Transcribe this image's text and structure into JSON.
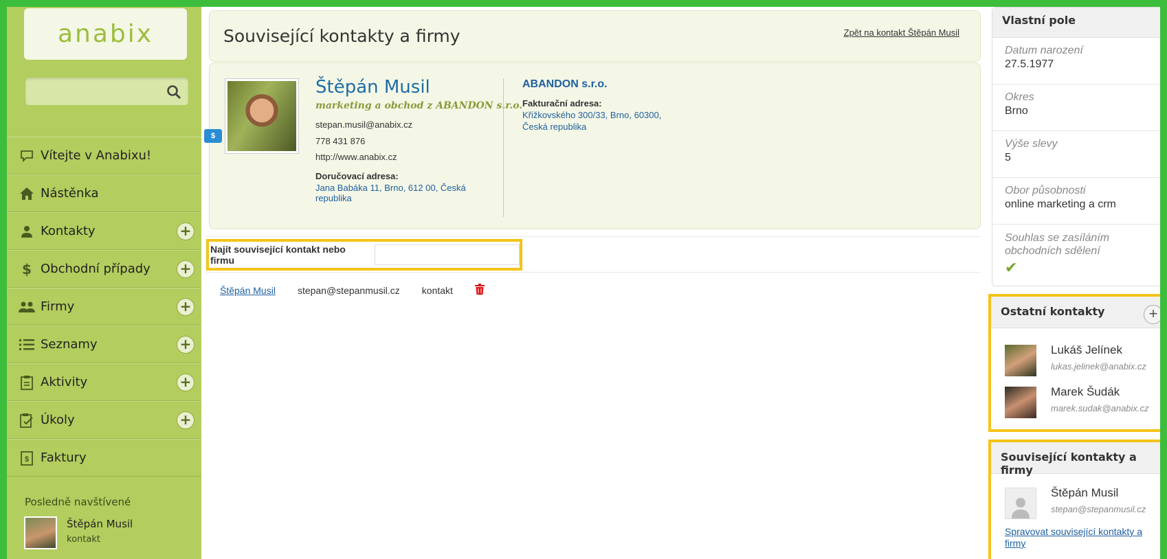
{
  "sidebar": {
    "logo": "anabix",
    "nav": [
      {
        "label": "Vítejte v Anabixu!",
        "icon": "chat-icon",
        "plus": false
      },
      {
        "label": "Nástěnka",
        "icon": "home-icon",
        "plus": false
      },
      {
        "label": "Kontakty",
        "icon": "person-icon",
        "plus": true
      },
      {
        "label": "Obchodní případy",
        "icon": "dollar-icon",
        "plus": true
      },
      {
        "label": "Firmy",
        "icon": "group-icon",
        "plus": true
      },
      {
        "label": "Seznamy",
        "icon": "list-icon",
        "plus": true
      },
      {
        "label": "Aktivity",
        "icon": "clipboard-icon",
        "plus": true
      },
      {
        "label": "Úkoly",
        "icon": "task-icon",
        "plus": true
      },
      {
        "label": "Faktury",
        "icon": "invoice-icon",
        "plus": false
      }
    ],
    "recent_title": "Posledně navštívené",
    "recent": {
      "name": "Štěpán Musil",
      "type": "kontakt"
    }
  },
  "header": {
    "title": "Související kontakty a firmy",
    "back_link": "Zpět na kontakt Štěpán Musil"
  },
  "contact": {
    "badge": "$",
    "name": "Štěpán Musil",
    "role_prefix": "marketing a obchod z",
    "role_company": "ABANDON s.r.o.",
    "email": "stepan.musil@anabix.cz",
    "phone": "778 431 876",
    "web": "http://www.anabix.cz",
    "delivery_label": "Doručovací adresa:",
    "delivery_line1": "Jana Babáka 11, Brno, 612 00, Česká",
    "delivery_line2": "republika",
    "company": "ABANDON s.r.o.",
    "billing_label": "Fakturační adresa:",
    "billing_line1": "Křižkovského 300/33, Brno, 60300,",
    "billing_line2": "Česká republika"
  },
  "find": {
    "label": "Najít související kontakt nebo firmu",
    "placeholder": ""
  },
  "related_row": {
    "name": "Štěpán Musil",
    "email": "stepan@stepanmusil.cz",
    "type": "kontakt"
  },
  "custom_fields": {
    "title": "Vlastní pole",
    "fields": [
      {
        "label": "Datum narození",
        "value": "27.5.1977"
      },
      {
        "label": "Okres",
        "value": "Brno"
      },
      {
        "label": "Výše slevy",
        "value": "5"
      },
      {
        "label": "Obor působnosti",
        "value": "online marketing a crm"
      },
      {
        "label": "Souhlas se zasíláním obchodních sdělení",
        "value": "✔"
      }
    ]
  },
  "other_contacts": {
    "title": "Ostatní kontakty",
    "people": [
      {
        "name": "Lukáš Jelínek",
        "email": "lukas.jelinek@anabix.cz"
      },
      {
        "name": "Marek Šudák",
        "email": "marek.sudak@anabix.cz"
      }
    ]
  },
  "related_box": {
    "title": "Související kontakty a firmy",
    "person": {
      "name": "Štěpán Musil",
      "email": "stepan@stepanmusil.cz"
    },
    "manage_link": "Spravovat související kontakty a firmy"
  },
  "colors": {
    "frame": "#3cbe3c",
    "sidebar": "#b3cd5e",
    "highlight": "#f5c318",
    "link": "#1f5fa0"
  }
}
